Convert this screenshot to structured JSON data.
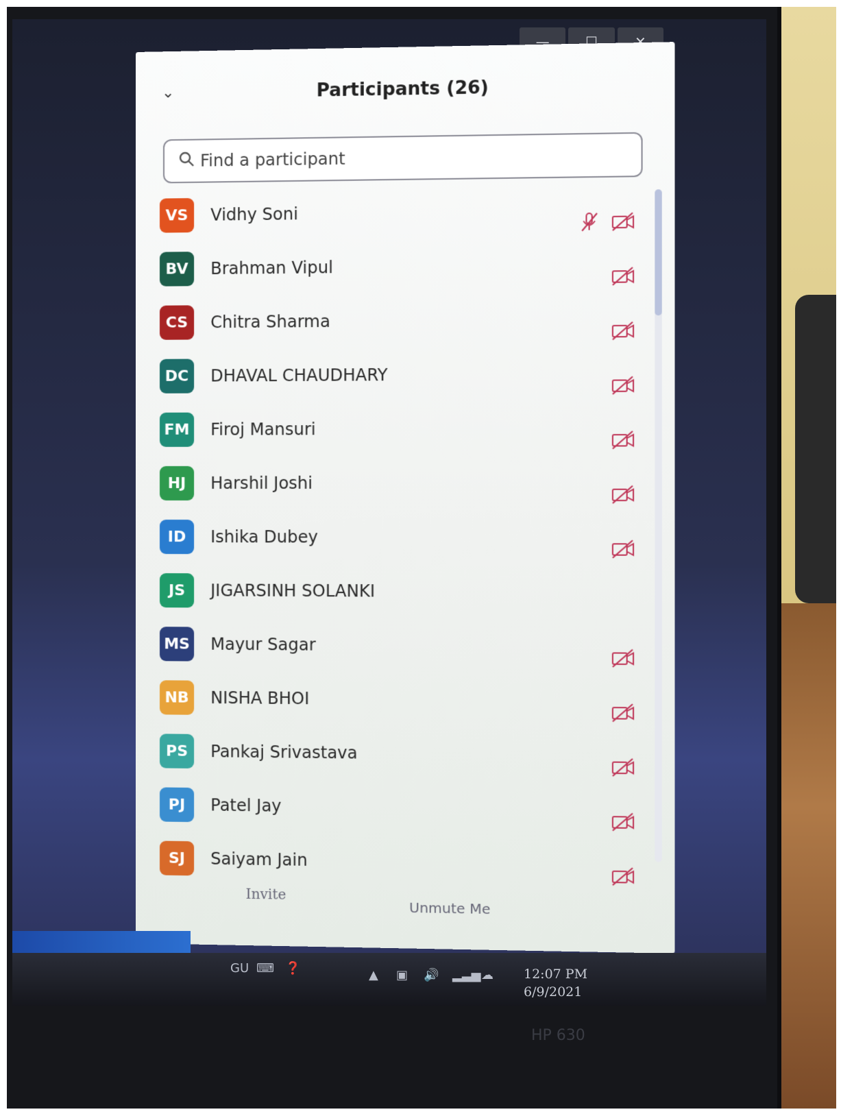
{
  "window": {
    "minimize": "—",
    "maximize": "☐",
    "close": "✕"
  },
  "panel": {
    "title": "Participants (26)",
    "search_placeholder": "Find a participant"
  },
  "participants": [
    {
      "initials": "VS",
      "name": "Vidhy Soni",
      "color": "#e2531f",
      "mic_muted": true,
      "video_off": true
    },
    {
      "initials": "BV",
      "name": "Brahman Vipul",
      "color": "#1d5e4a",
      "mic_muted": false,
      "video_off": true
    },
    {
      "initials": "CS",
      "name": "Chitra Sharma",
      "color": "#a82424",
      "mic_muted": false,
      "video_off": true
    },
    {
      "initials": "DC",
      "name": "DHAVAL CHAUDHARY",
      "color": "#1d6e6a",
      "mic_muted": false,
      "video_off": true
    },
    {
      "initials": "FM",
      "name": "Firoj Mansuri",
      "color": "#1f8e78",
      "mic_muted": false,
      "video_off": true
    },
    {
      "initials": "HJ",
      "name": "Harshil Joshi",
      "color": "#2e9a4e",
      "mic_muted": false,
      "video_off": true
    },
    {
      "initials": "ID",
      "name": "Ishika Dubey",
      "color": "#2a7dd0",
      "mic_muted": false,
      "video_off": true
    },
    {
      "initials": "JS",
      "name": "JIGARSINH SOLANKI",
      "color": "#1f9c6a",
      "mic_muted": false,
      "video_off": false
    },
    {
      "initials": "MS",
      "name": "Mayur Sagar",
      "color": "#2c3f7a",
      "mic_muted": false,
      "video_off": true
    },
    {
      "initials": "NB",
      "name": "NISHA BHOI",
      "color": "#e8a33a",
      "mic_muted": false,
      "video_off": true
    },
    {
      "initials": "PS",
      "name": "Pankaj Srivastava",
      "color": "#3aa8a0",
      "mic_muted": false,
      "video_off": true
    },
    {
      "initials": "PJ",
      "name": "Patel Jay",
      "color": "#3a8ed0",
      "mic_muted": false,
      "video_off": true
    },
    {
      "initials": "SJ",
      "name": "Saiyam Jain",
      "color": "#d86a2a",
      "mic_muted": false,
      "video_off": true
    }
  ],
  "footer": {
    "invite_label": "Invite",
    "unmute_label": "Unmute Me"
  },
  "taskbar": {
    "language": "GU",
    "time": "12:07 PM",
    "date": "6/9/2021"
  },
  "device": {
    "brand": "HP 630"
  }
}
